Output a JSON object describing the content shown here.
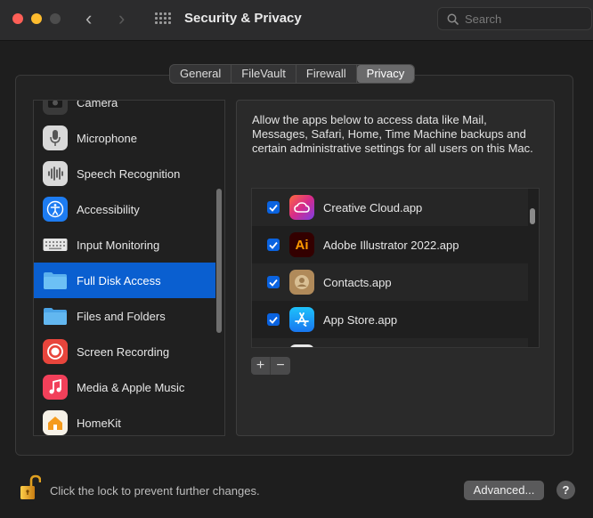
{
  "window": {
    "title": "Security & Privacy",
    "search_placeholder": "Search"
  },
  "tabs": [
    {
      "label": "General"
    },
    {
      "label": "FileVault"
    },
    {
      "label": "Firewall"
    },
    {
      "label": "Privacy",
      "active": true
    }
  ],
  "sidebar": {
    "items": [
      {
        "label": "Camera",
        "icon": "camera-icon"
      },
      {
        "label": "Microphone",
        "icon": "microphone-icon"
      },
      {
        "label": "Speech Recognition",
        "icon": "speech-recognition-icon"
      },
      {
        "label": "Accessibility",
        "icon": "accessibility-icon"
      },
      {
        "label": "Input Monitoring",
        "icon": "keyboard-icon"
      },
      {
        "label": "Full Disk Access",
        "icon": "folder-icon",
        "selected": true
      },
      {
        "label": "Files and Folders",
        "icon": "folder-icon"
      },
      {
        "label": "Screen Recording",
        "icon": "screen-recording-icon"
      },
      {
        "label": "Media & Apple Music",
        "icon": "music-icon"
      },
      {
        "label": "HomeKit",
        "icon": "home-icon"
      }
    ]
  },
  "detail": {
    "description": "Allow the apps below to access data like Mail, Messages, Safari, Home, Time Machine backups and certain administrative settings for all users on this Mac.",
    "apps": [
      {
        "name": "Creative Cloud.app",
        "checked": true,
        "icon": "creative-cloud-icon"
      },
      {
        "name": "Adobe Illustrator 2022.app",
        "checked": true,
        "icon": "illustrator-icon"
      },
      {
        "name": "Contacts.app",
        "checked": true,
        "icon": "contacts-icon"
      },
      {
        "name": "App Store.app",
        "checked": true,
        "icon": "app-store-icon"
      }
    ],
    "add_label": "+",
    "remove_label": "−"
  },
  "footer": {
    "lock_text": "Click the lock to prevent further changes.",
    "advanced_label": "Advanced...",
    "help_label": "?"
  },
  "colors": {
    "accent": "#0a5fd0",
    "checkbox": "#0a63e0"
  }
}
